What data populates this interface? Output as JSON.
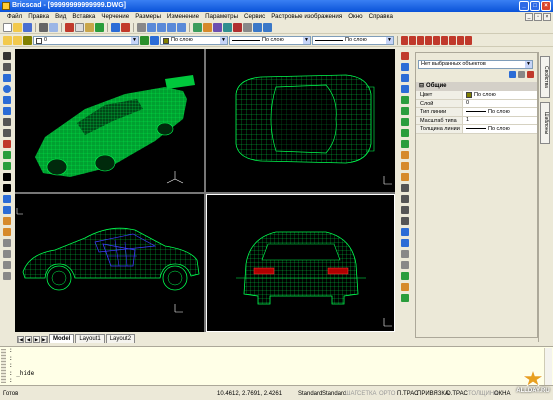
{
  "window": {
    "title": "Bricscad - [99999999999999.DWG]"
  },
  "menu": [
    "Файл",
    "Правка",
    "Вид",
    "Вставка",
    "Черчение",
    "Размеры",
    "Изменение",
    "Параметры",
    "Сервис",
    "Растровые изображения",
    "Окно",
    "Справка"
  ],
  "toolbar": {
    "layer_value": "0",
    "color_value": "По слою",
    "linetype_value": "По слою",
    "lineweight_value": "По слою"
  },
  "colors": {
    "model_green": "#00c83c",
    "mesh_green": "#00ff50",
    "mesh_blue": "#3c3cff",
    "titlebar": "#0a52d8"
  },
  "layout_tabs": [
    {
      "label": "Model",
      "active": true
    },
    {
      "label": "Layout1"
    },
    {
      "label": "Layout2"
    }
  ],
  "properties": {
    "selection": "Нет выбранных объектов",
    "group": "Общие",
    "rows": [
      {
        "key": "Цвет",
        "value": "По слою"
      },
      {
        "key": "Слой",
        "value": "0"
      },
      {
        "key": "Тип линии",
        "value": "По слою"
      },
      {
        "key": "Масштаб типа",
        "value": "1"
      },
      {
        "key": "Толщина линии",
        "value": "По слою"
      }
    ],
    "side_tabs": [
      "Свойства",
      "Шаблоны"
    ]
  },
  "command": {
    "lines": [
      ":",
      ":",
      ":",
      ": _hide",
      ":"
    ]
  },
  "status": {
    "left": "Готов",
    "coords": "10.4612, 2.7691, 2.4261",
    "style1": "Standard",
    "style2": "Standard",
    "toggles": [
      {
        "label": "ШАГ",
        "on": false
      },
      {
        "label": "СЕТКА",
        "on": false
      },
      {
        "label": "ОРТО",
        "on": false
      },
      {
        "label": "П.ТРАС",
        "on": true
      },
      {
        "label": "ПРИВЯЗКА",
        "on": true
      },
      {
        "label": "О.ТРАС",
        "on": true
      },
      {
        "label": "ТОЛЩИНА",
        "on": false
      },
      {
        "label": "ОКНА",
        "on": true
      }
    ]
  },
  "watermark": {
    "line1": "ALLDAY.RU"
  }
}
